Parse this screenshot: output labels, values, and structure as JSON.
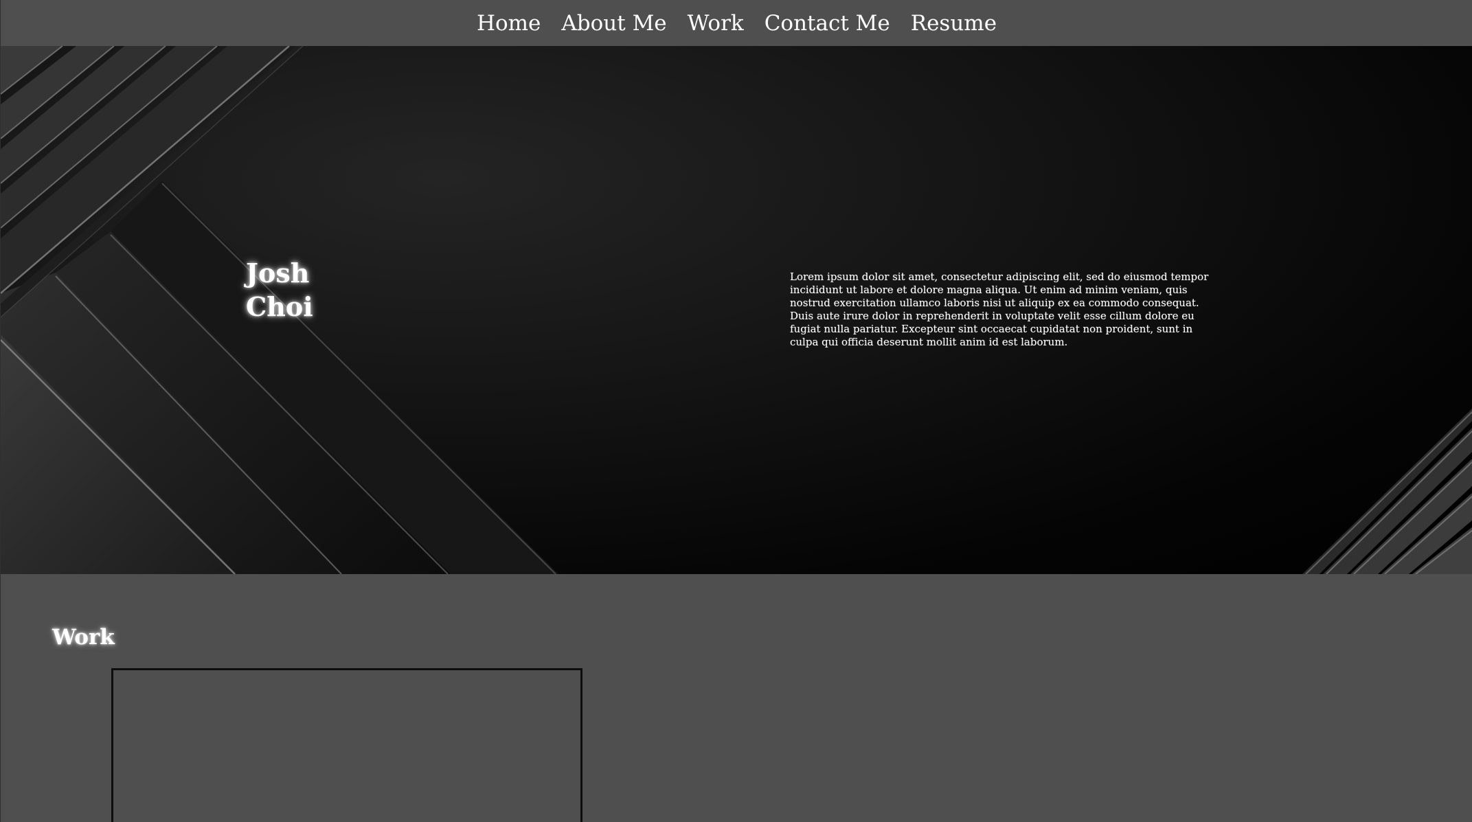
{
  "nav": {
    "items": [
      {
        "label": "Home"
      },
      {
        "label": "About Me"
      },
      {
        "label": "Work"
      },
      {
        "label": "Contact Me"
      },
      {
        "label": "Resume"
      }
    ]
  },
  "hero": {
    "name_first": "Josh",
    "name_last": "Choi",
    "bio": "Lorem ipsum dolor sit amet, consectetur adipiscing elit, sed do eiusmod tempor incididunt ut labore et dolore magna aliqua. Ut enim ad minim veniam, quis nostrud exercitation ullamco laboris nisi ut aliquip ex ea commodo consequat. Duis aute irure dolor in reprehenderit in voluptate velit esse cillum dolore eu fugiat nulla pariatur. Excepteur sint occaecat cupidatat non proident, sunt in culpa qui officia deserunt mollit anim id est laborum."
  },
  "work": {
    "title": "Work"
  },
  "colors": {
    "page_bg": "#4f4f4f",
    "hero_bg": "#000000",
    "text": "#ffffff"
  }
}
